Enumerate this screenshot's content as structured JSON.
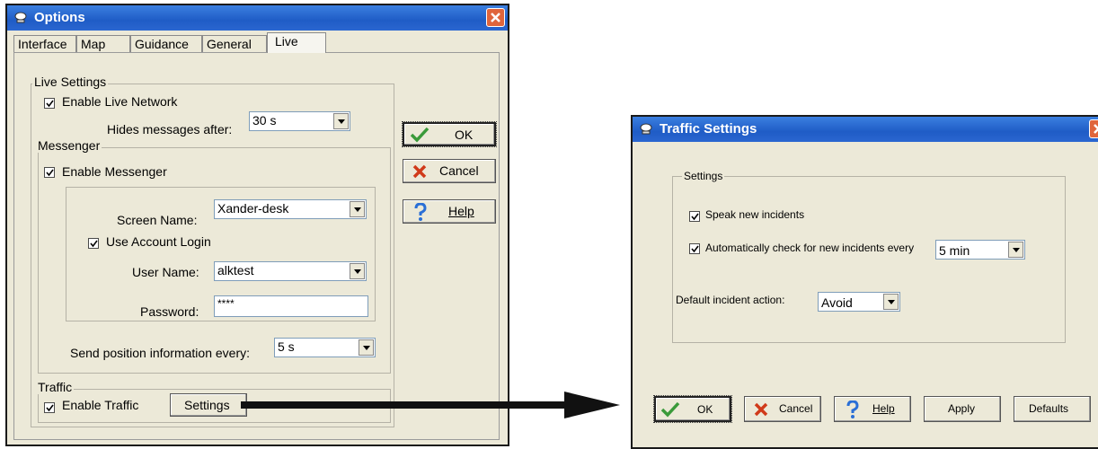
{
  "options": {
    "title": "Options",
    "tabs": [
      "Interface",
      "Map",
      "Guidance",
      "General",
      "Live"
    ],
    "live_settings": {
      "group_label": "Live Settings",
      "enable_live_network": "Enable Live Network",
      "hides_messages_label": "Hides messages after:",
      "hides_messages_value": "30 s"
    },
    "messenger": {
      "group_label": "Messenger",
      "enable_messenger": "Enable Messenger",
      "screen_name_label": "Screen Name:",
      "screen_name_value": "Xander-desk",
      "use_account_login": "Use Account Login",
      "user_name_label": "User Name:",
      "user_name_value": "alktest",
      "password_label": "Password:",
      "password_value": "****",
      "send_position_label": "Send position information every:",
      "send_position_value": "5 s"
    },
    "traffic": {
      "group_label": "Traffic",
      "enable_traffic": "Enable Traffic",
      "settings_button": "Settings"
    },
    "buttons": {
      "ok": "OK",
      "cancel": "Cancel",
      "help": "Help"
    }
  },
  "traffic_settings": {
    "title": "Traffic Settings",
    "group_label": "Settings",
    "speak_new_incidents": "Speak new incidents",
    "auto_check_label": "Automatically check for new incidents every",
    "auto_check_value": "5 min",
    "default_action_label": "Default incident action:",
    "default_action_value": "Avoid",
    "buttons": {
      "ok": "OK",
      "cancel": "Cancel",
      "help": "Help",
      "apply": "Apply",
      "defaults": "Defaults"
    }
  },
  "colors": {
    "titlebar": "#2a66d0",
    "window_bg": "#ece9d8",
    "close": "#e0653c",
    "check_green": "#3a9a3a",
    "cancel_red": "#d03a1a",
    "help_blue": "#2a6fd6"
  }
}
